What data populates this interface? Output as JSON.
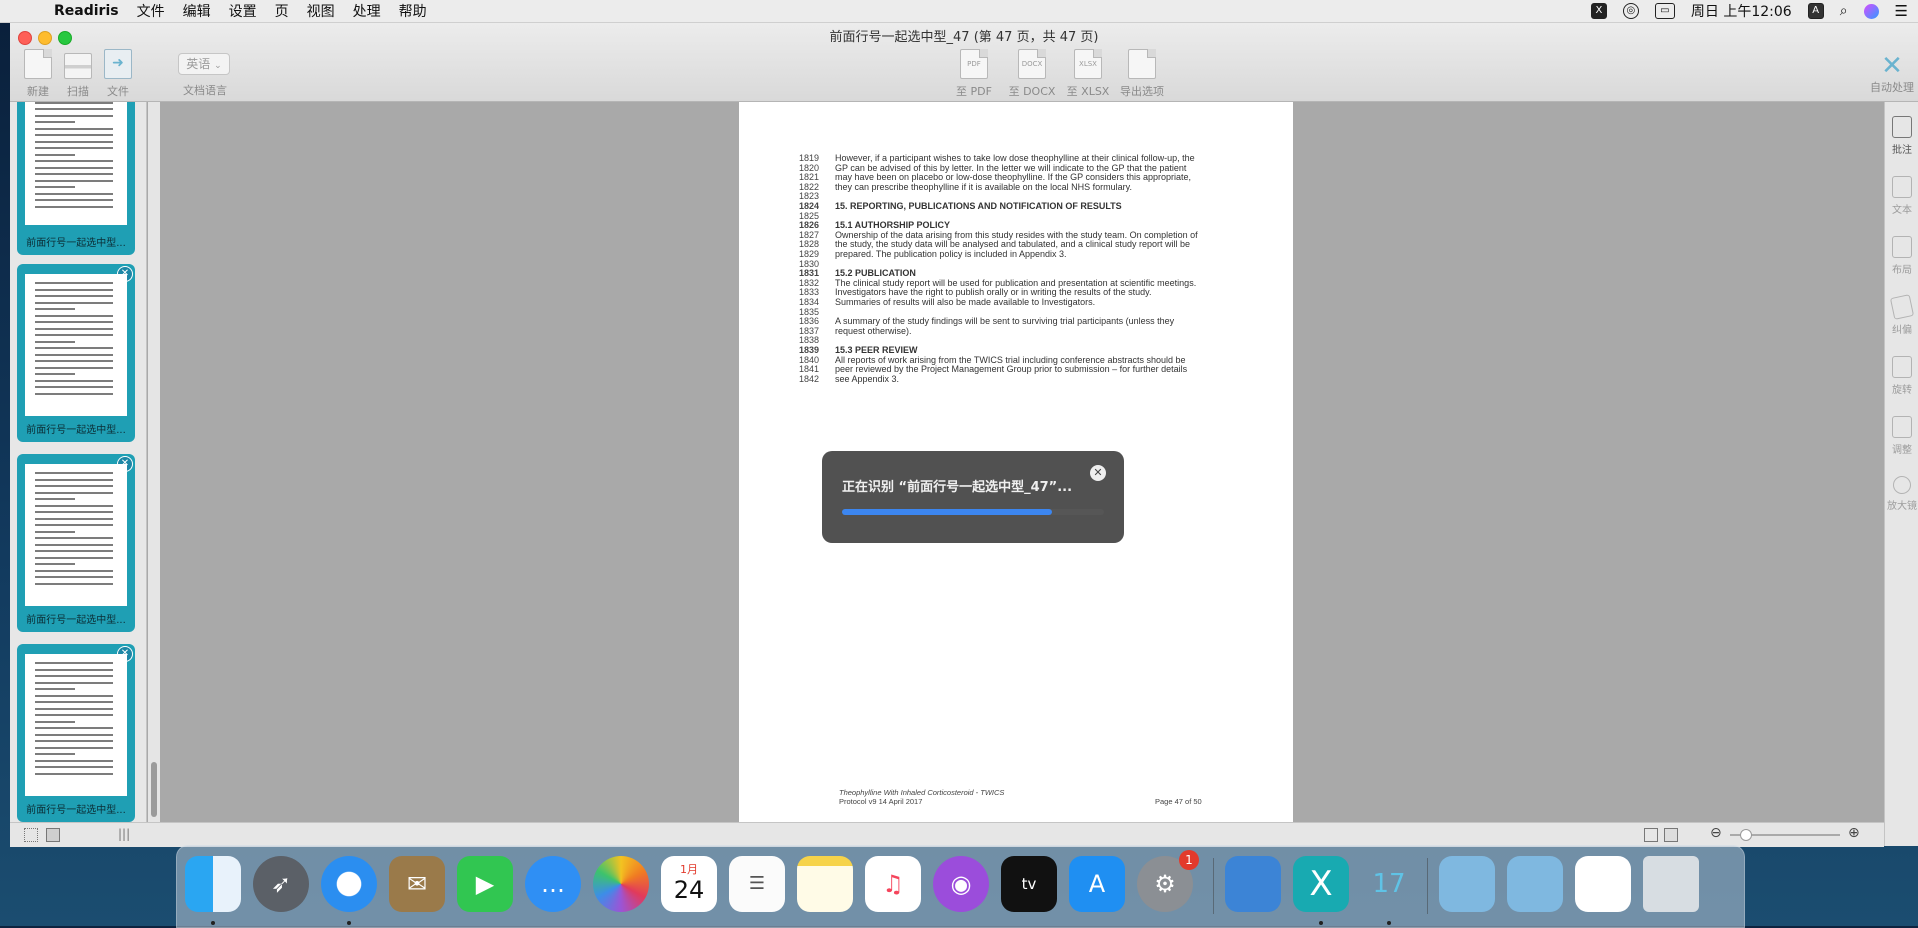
{
  "menubar": {
    "app_name": "Readiris",
    "items": [
      "文件",
      "编辑",
      "设置",
      "页",
      "视图",
      "处理",
      "帮助"
    ],
    "clock": "周日 上午12:06",
    "input_indicator": "A"
  },
  "window": {
    "title": "前面行号一起选中型_47 (第 47 页，共 47 页)"
  },
  "toolbar": {
    "new_label": "新建",
    "scan_label": "扫描",
    "file_label": "文件",
    "lang_value": "英语",
    "lang_label": "文档语言",
    "export_pdf": "至 PDF",
    "export_docx": "至 DOCX",
    "export_xlsx": "至 XLSX",
    "export_options": "导出选项",
    "auto_process": "自动处理",
    "fmt_pdf": "PDF",
    "fmt_docx": "DOCX",
    "fmt_xlsx": "XLSX"
  },
  "thumbnails": [
    {
      "caption": "前面行号一起选中型..."
    },
    {
      "caption": "前面行号一起选中型..."
    },
    {
      "caption": "前面行号一起选中型..."
    },
    {
      "caption": "前面行号一起选中型..."
    }
  ],
  "document": {
    "lines": [
      {
        "num": "1819",
        "text": "However, if a participant wishes to take low dose theophylline at their clinical follow-up, the",
        "bold": false
      },
      {
        "num": "1820",
        "text": "GP can be advised of this by letter. In the letter we will indicate to the GP that the patient",
        "bold": false
      },
      {
        "num": "1821",
        "text": "may have been on placebo or low-dose theophylline. If the GP considers this appropriate,",
        "bold": false
      },
      {
        "num": "1822",
        "text": "they can prescribe theophylline if it is available on the local NHS formulary.",
        "bold": false
      },
      {
        "num": "1823",
        "text": "",
        "bold": false
      },
      {
        "num": "1824",
        "text": "15.      REPORTING, PUBLICATIONS AND NOTIFICATION OF RESULTS",
        "bold": true
      },
      {
        "num": "1825",
        "text": "",
        "bold": false
      },
      {
        "num": "1826",
        "text": "15.1      AUTHORSHIP POLICY",
        "bold": true
      },
      {
        "num": "1827",
        "text": "Ownership of the data arising from this study resides with the study team. On completion of",
        "bold": false
      },
      {
        "num": "1828",
        "text": "the study, the study data will be analysed and tabulated, and a clinical study report will be",
        "bold": false
      },
      {
        "num": "1829",
        "text": "prepared. The publication policy is included in Appendix 3.",
        "bold": false
      },
      {
        "num": "1830",
        "text": "",
        "bold": false
      },
      {
        "num": "1831",
        "text": "15.2      PUBLICATION",
        "bold": true
      },
      {
        "num": "1832",
        "text": "The clinical study report will be used for publication and presentation at scientific meetings.",
        "bold": false
      },
      {
        "num": "1833",
        "text": "Investigators have the right to publish orally or in writing the results of the study.",
        "bold": false
      },
      {
        "num": "1834",
        "text": "Summaries of results will also be made available to Investigators.",
        "bold": false
      },
      {
        "num": "1835",
        "text": "",
        "bold": false
      },
      {
        "num": "1836",
        "text": "A summary of the study findings will be sent to surviving trial participants (unless they",
        "bold": false
      },
      {
        "num": "1837",
        "text": "request otherwise).",
        "bold": false
      },
      {
        "num": "1838",
        "text": "",
        "bold": false
      },
      {
        "num": "1839",
        "text": "15.3      PEER REVIEW",
        "bold": true
      },
      {
        "num": "1840",
        "text": "All reports of work arising from the TWICS trial including conference abstracts should be",
        "bold": false
      },
      {
        "num": "1841",
        "text": "peer reviewed by the Project Management Group prior to submission – for further details",
        "bold": false
      },
      {
        "num": "1842",
        "text": "see Appendix 3.",
        "bold": false
      }
    ],
    "footer_left_1": "Theophylline With Inhaled Corticosteroid - TWICS",
    "footer_left_2": "Protocol v9     14 April 2017",
    "footer_right": "Page 47 of 50"
  },
  "progress_dialog": {
    "message": "正在识别 “前面行号一起选中型_47”...",
    "progress": 0.8
  },
  "right_panel": [
    {
      "label": "批注",
      "active": true
    },
    {
      "label": "文本",
      "active": false
    },
    {
      "label": "布局",
      "active": false
    },
    {
      "label": "纠偏",
      "active": false
    },
    {
      "label": "旋转",
      "active": false
    },
    {
      "label": "调整",
      "active": false
    },
    {
      "label": "放大镜",
      "active": false
    }
  ],
  "dock": {
    "calendar_month": "1月",
    "calendar_day": "24",
    "settings_badge": "1",
    "app17_label": "17"
  },
  "colors": {
    "thumb_accent": "#1f9fb4",
    "progress_fill": "#3c86f0"
  }
}
